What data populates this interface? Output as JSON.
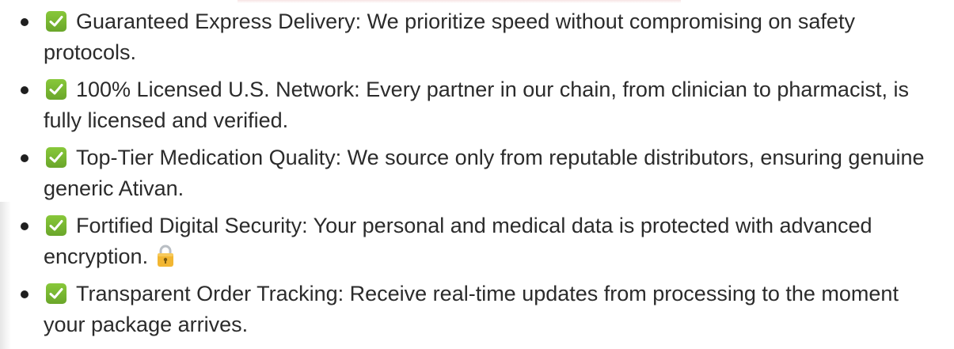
{
  "features": [
    {
      "icon": "checkmark-icon",
      "text": "Guaranteed Express Delivery: We prioritize speed without compromising on safety protocols."
    },
    {
      "icon": "checkmark-icon",
      "text": "100% Licensed U.S. Network: Every partner in our chain, from clinician to pharmacist, is fully licensed and verified."
    },
    {
      "icon": "checkmark-icon",
      "text": "Top-Tier Medication Quality: We source only from reputable distributors, ensuring genuine generic Ativan."
    },
    {
      "icon": "checkmark-icon",
      "text": "Fortified Digital Security: Your personal and medical data is protected with advanced encryption.",
      "trailing_icon": "lock-icon"
    },
    {
      "icon": "checkmark-icon",
      "text": "Transparent Order Tracking: Receive real-time updates from processing to the moment your package arrives."
    }
  ],
  "colors": {
    "check_green": "#77b82f",
    "text": "#2b2b2b",
    "lock_gold": "#f2b632"
  }
}
